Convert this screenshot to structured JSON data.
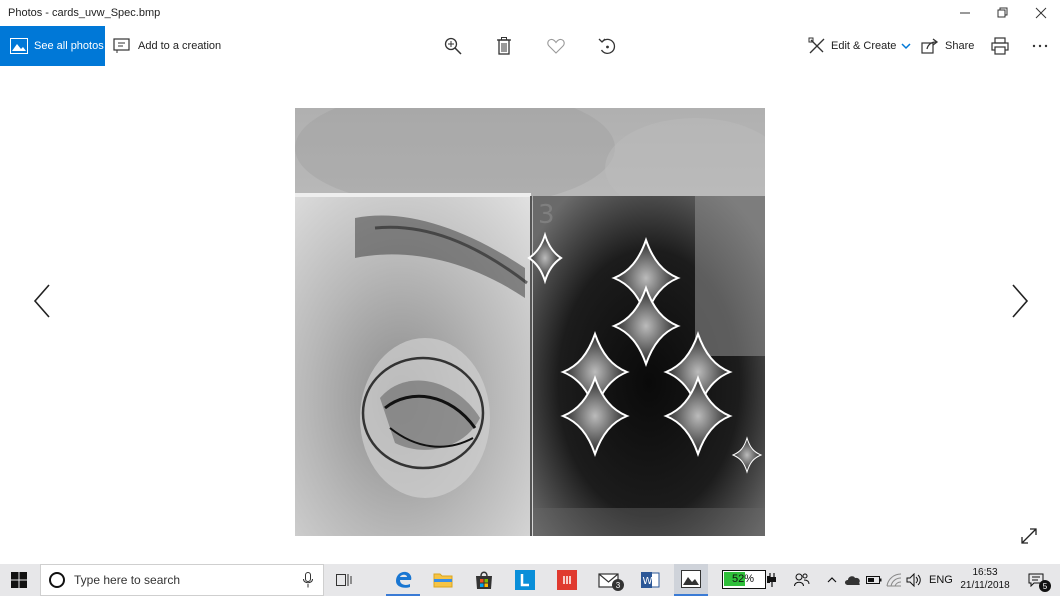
{
  "window": {
    "title": "Photos - cards_uvw_Spec.bmp"
  },
  "toolbar": {
    "see_all_label": "See all photos",
    "add_creation_label": "Add to a creation",
    "edit_create_label": "Edit & Create",
    "share_label": "Share"
  },
  "photo": {
    "card_number": "3"
  },
  "taskbar": {
    "search_placeholder": "Type here to search",
    "battery_percent": "52%",
    "mail_badge": "3",
    "language": "ENG",
    "time": "16:53",
    "date": "21/11/2018",
    "notification_count": "5"
  },
  "colors": {
    "accent": "#0078d7",
    "taskbar_bg": "#e7e7e9",
    "battery_green": "#2fbf3a"
  }
}
